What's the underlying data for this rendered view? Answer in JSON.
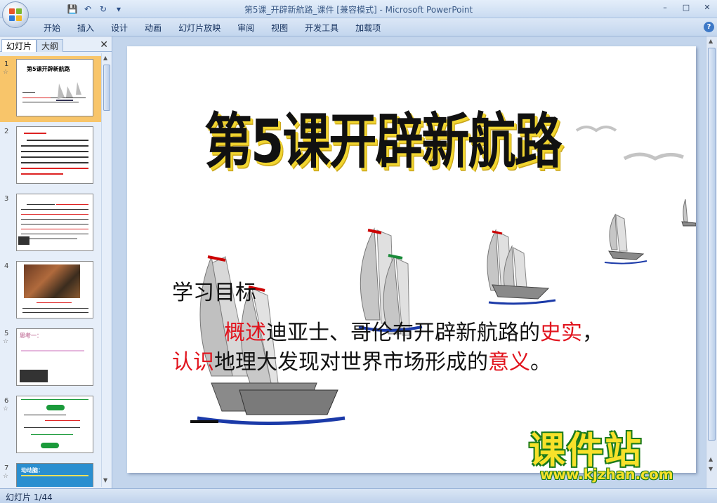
{
  "window": {
    "title": "第5课_开辟新航路_课件 [兼容模式] - Microsoft PowerPoint",
    "minimize": "–",
    "maximize": "□",
    "close": "✕"
  },
  "quick_access": {
    "save_icon": "💾",
    "undo_icon": "↶",
    "redo_icon": "↻",
    "more": "▾"
  },
  "ribbon": {
    "tabs": [
      "开始",
      "插入",
      "设计",
      "动画",
      "幻灯片放映",
      "审阅",
      "视图",
      "开发工具",
      "加载项"
    ],
    "help": "?"
  },
  "panel": {
    "tabs": [
      "幻灯片",
      "大纲"
    ],
    "close": "✕",
    "thumbnails": [
      {
        "number": "1",
        "title": "第5课开辟新航路"
      },
      {
        "number": "2",
        "title": ""
      },
      {
        "number": "3",
        "title": ""
      },
      {
        "number": "4",
        "title": ""
      },
      {
        "number": "5",
        "title": "思考一："
      },
      {
        "number": "6",
        "title": ""
      },
      {
        "number": "7",
        "title": "动动脑："
      }
    ]
  },
  "slide": {
    "title": "第5课开辟新航路",
    "heading": "学习目标",
    "body": {
      "w1": "概述",
      "t1": "迪亚士、哥伦布开辟新航路的",
      "w2": "史实",
      "t2": "，",
      "w3": "认识",
      "t3": "地理大发现对世界市场形成的",
      "w4": "意义",
      "t4": "。"
    },
    "colors": {
      "keyword": "#e1141e",
      "title_shadow": "#f1d530"
    }
  },
  "watermark": {
    "main": "课件站",
    "url": "www.kjzhan.com"
  },
  "status": {
    "text": "幻灯片 1/44"
  }
}
